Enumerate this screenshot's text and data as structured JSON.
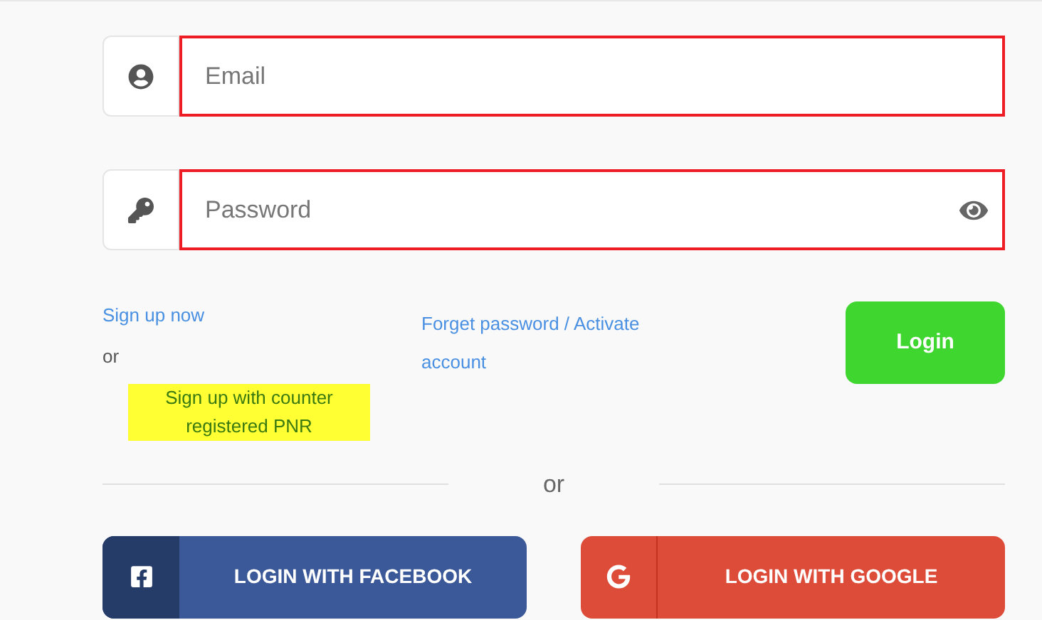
{
  "fields": [
    {
      "kind": "email",
      "placeholder": "Email",
      "invalid": true
    },
    {
      "kind": "password",
      "placeholder": "Password",
      "invalid": true
    }
  ],
  "links": {
    "signup": "Sign up now",
    "or": "or",
    "counter_signup": {
      "text": "Sign up with counter registered PNR",
      "highlighted": true
    },
    "forgot": "Forget password / Activate account"
  },
  "login_button": "Login",
  "divider": "or",
  "social": [
    {
      "kind": "facebook",
      "label": "LOGIN WITH FACEBOOK"
    },
    {
      "kind": "google",
      "label": "LOGIN WITH GOOGLE"
    }
  ]
}
